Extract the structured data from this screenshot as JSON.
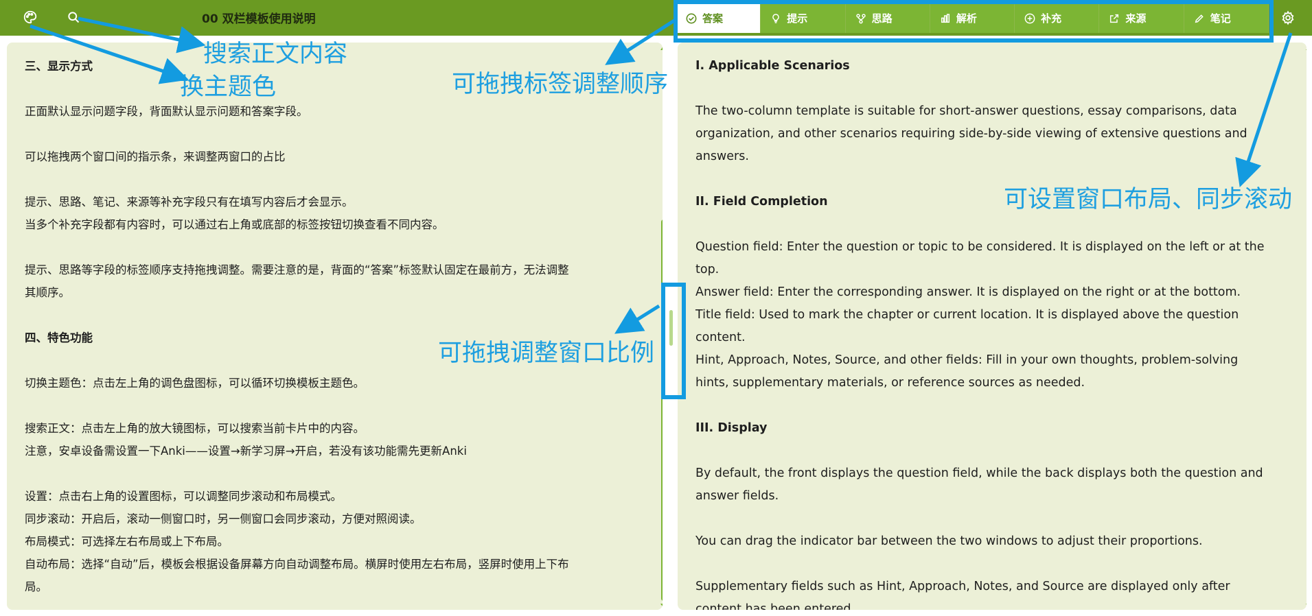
{
  "header": {
    "title": "00 双栏模板使用说明",
    "theme_icon": "palette-icon",
    "search_icon": "search-icon",
    "settings_icon": "gear-icon"
  },
  "tabs": [
    {
      "label": "答案",
      "icon": "check-circle-icon",
      "active": true
    },
    {
      "label": "提示",
      "icon": "lightbulb-icon",
      "active": false
    },
    {
      "label": "思路",
      "icon": "branch-icon",
      "active": false
    },
    {
      "label": "解析",
      "icon": "bar-chart-icon",
      "active": false
    },
    {
      "label": "补充",
      "icon": "plus-circle-icon",
      "active": false
    },
    {
      "label": "来源",
      "icon": "external-link-icon",
      "active": false
    },
    {
      "label": "笔记",
      "icon": "pencil-icon",
      "active": false
    }
  ],
  "left_pane": {
    "lines": [
      {
        "text": "三、显示方式",
        "heading": true
      },
      {
        "text": "",
        "blank": true
      },
      {
        "text": "正面默认显示问题字段，背面默认显示问题和答案字段。"
      },
      {
        "text": "",
        "blank": true
      },
      {
        "text": "可以拖拽两个窗口间的指示条，来调整两窗口的占比"
      },
      {
        "text": "",
        "blank": true
      },
      {
        "text": "提示、思路、笔记、来源等补充字段只有在填写内容后才会显示。"
      },
      {
        "text": "当多个补充字段都有内容时，可以通过右上角或底部的标签按钮切换查看不同内容。"
      },
      {
        "text": "",
        "blank": true
      },
      {
        "text": "提示、思路等字段的标签顺序支持拖拽调整。需要注意的是，背面的“答案”标签默认固定在最前方，无法调整"
      },
      {
        "text": "其顺序。"
      },
      {
        "text": "",
        "blank": true
      },
      {
        "text": "四、特色功能",
        "heading": true
      },
      {
        "text": "",
        "blank": true
      },
      {
        "text": "切换主题色：点击左上角的调色盘图标，可以循环切换模板主题色。"
      },
      {
        "text": "",
        "blank": true
      },
      {
        "text": "搜索正文：点击左上角的放大镜图标，可以搜索当前卡片中的内容。"
      },
      {
        "text": "注意，安卓设备需设置一下Anki——设置→新学习屏→开启，若没有该功能需先更新Anki"
      },
      {
        "text": "",
        "blank": true
      },
      {
        "text": "设置：点击右上角的设置图标，可以调整同步滚动和布局模式。"
      },
      {
        "text": "同步滚动：开启后，滚动一侧窗口时，另一侧窗口会同步滚动，方便对照阅读。"
      },
      {
        "text": "布局模式：可选择左右布局或上下布局。"
      },
      {
        "text": "自动布局：选择“自动”后，模板会根据设备屏幕方向自动调整布局。横屏时使用左右布局，竖屏时使用上下布"
      },
      {
        "text": "局。"
      }
    ]
  },
  "right_pane": {
    "lines": [
      {
        "text": "I. Applicable Scenarios",
        "heading": true
      },
      {
        "text": "",
        "blank": true
      },
      {
        "text": "The two-column template is suitable for short-answer questions, essay comparisons, data"
      },
      {
        "text": "organization, and other scenarios requiring side-by-side viewing of extensive questions and"
      },
      {
        "text": "answers."
      },
      {
        "text": "",
        "blank": true
      },
      {
        "text": "II. Field Completion",
        "heading": true
      },
      {
        "text": "",
        "blank": true
      },
      {
        "text": "Question field: Enter the question or topic to be considered. It is displayed on the left or at the"
      },
      {
        "text": "top."
      },
      {
        "text": "Answer field: Enter the corresponding answer. It is displayed on the right or at the bottom."
      },
      {
        "text": "Title field: Used to mark the chapter or current location. It is displayed above the question"
      },
      {
        "text": "content."
      },
      {
        "text": "Hint, Approach, Notes, Source, and other fields: Fill in your own thoughts, problem-solving"
      },
      {
        "text": "hints, supplementary materials, or reference sources as needed."
      },
      {
        "text": "",
        "blank": true
      },
      {
        "text": "III. Display",
        "heading": true
      },
      {
        "text": "",
        "blank": true
      },
      {
        "text": "By default, the front displays the question field, while the back displays both the question and"
      },
      {
        "text": "answer fields."
      },
      {
        "text": "",
        "blank": true
      },
      {
        "text": "You can drag the indicator bar between the two windows to adjust their proportions."
      },
      {
        "text": "",
        "blank": true
      },
      {
        "text": "Supplementary fields such as Hint, Approach, Notes, and Source are displayed only after"
      },
      {
        "text": "content has been entered."
      }
    ]
  },
  "annotations": {
    "search": "搜索正文内容",
    "theme": "换主题色",
    "drag_tabs": "可拖拽标签调整顺序",
    "drag_ratio": "可拖拽调整窗口比例",
    "settings": "可设置窗口布局、同步滚动"
  },
  "colors": {
    "topbar": "#6a9a22",
    "tab": "#7cb534",
    "pane": "#ecf0d7",
    "annotation": "#1e9fe0"
  }
}
